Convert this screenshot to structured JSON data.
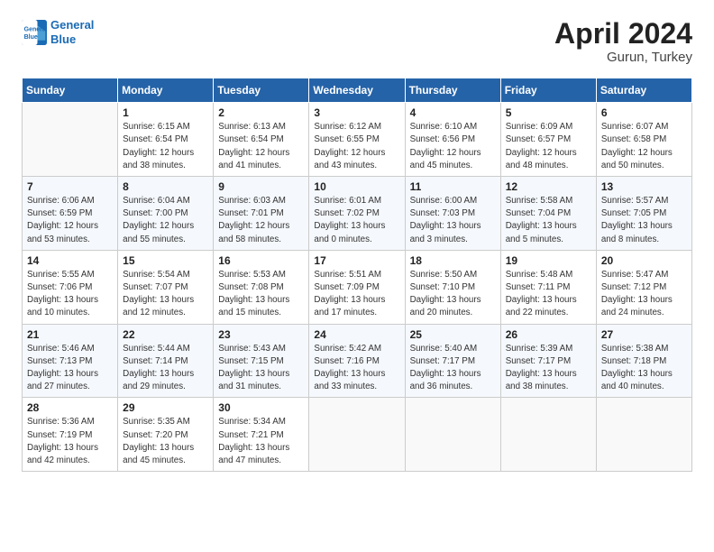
{
  "header": {
    "logo_line1": "General",
    "logo_line2": "Blue",
    "title": "April 2024",
    "location": "Gurun, Turkey"
  },
  "weekdays": [
    "Sunday",
    "Monday",
    "Tuesday",
    "Wednesday",
    "Thursday",
    "Friday",
    "Saturday"
  ],
  "weeks": [
    [
      {
        "day": "",
        "info": ""
      },
      {
        "day": "1",
        "info": "Sunrise: 6:15 AM\nSunset: 6:54 PM\nDaylight: 12 hours\nand 38 minutes."
      },
      {
        "day": "2",
        "info": "Sunrise: 6:13 AM\nSunset: 6:54 PM\nDaylight: 12 hours\nand 41 minutes."
      },
      {
        "day": "3",
        "info": "Sunrise: 6:12 AM\nSunset: 6:55 PM\nDaylight: 12 hours\nand 43 minutes."
      },
      {
        "day": "4",
        "info": "Sunrise: 6:10 AM\nSunset: 6:56 PM\nDaylight: 12 hours\nand 45 minutes."
      },
      {
        "day": "5",
        "info": "Sunrise: 6:09 AM\nSunset: 6:57 PM\nDaylight: 12 hours\nand 48 minutes."
      },
      {
        "day": "6",
        "info": "Sunrise: 6:07 AM\nSunset: 6:58 PM\nDaylight: 12 hours\nand 50 minutes."
      }
    ],
    [
      {
        "day": "7",
        "info": "Sunrise: 6:06 AM\nSunset: 6:59 PM\nDaylight: 12 hours\nand 53 minutes."
      },
      {
        "day": "8",
        "info": "Sunrise: 6:04 AM\nSunset: 7:00 PM\nDaylight: 12 hours\nand 55 minutes."
      },
      {
        "day": "9",
        "info": "Sunrise: 6:03 AM\nSunset: 7:01 PM\nDaylight: 12 hours\nand 58 minutes."
      },
      {
        "day": "10",
        "info": "Sunrise: 6:01 AM\nSunset: 7:02 PM\nDaylight: 13 hours\nand 0 minutes."
      },
      {
        "day": "11",
        "info": "Sunrise: 6:00 AM\nSunset: 7:03 PM\nDaylight: 13 hours\nand 3 minutes."
      },
      {
        "day": "12",
        "info": "Sunrise: 5:58 AM\nSunset: 7:04 PM\nDaylight: 13 hours\nand 5 minutes."
      },
      {
        "day": "13",
        "info": "Sunrise: 5:57 AM\nSunset: 7:05 PM\nDaylight: 13 hours\nand 8 minutes."
      }
    ],
    [
      {
        "day": "14",
        "info": "Sunrise: 5:55 AM\nSunset: 7:06 PM\nDaylight: 13 hours\nand 10 minutes."
      },
      {
        "day": "15",
        "info": "Sunrise: 5:54 AM\nSunset: 7:07 PM\nDaylight: 13 hours\nand 12 minutes."
      },
      {
        "day": "16",
        "info": "Sunrise: 5:53 AM\nSunset: 7:08 PM\nDaylight: 13 hours\nand 15 minutes."
      },
      {
        "day": "17",
        "info": "Sunrise: 5:51 AM\nSunset: 7:09 PM\nDaylight: 13 hours\nand 17 minutes."
      },
      {
        "day": "18",
        "info": "Sunrise: 5:50 AM\nSunset: 7:10 PM\nDaylight: 13 hours\nand 20 minutes."
      },
      {
        "day": "19",
        "info": "Sunrise: 5:48 AM\nSunset: 7:11 PM\nDaylight: 13 hours\nand 22 minutes."
      },
      {
        "day": "20",
        "info": "Sunrise: 5:47 AM\nSunset: 7:12 PM\nDaylight: 13 hours\nand 24 minutes."
      }
    ],
    [
      {
        "day": "21",
        "info": "Sunrise: 5:46 AM\nSunset: 7:13 PM\nDaylight: 13 hours\nand 27 minutes."
      },
      {
        "day": "22",
        "info": "Sunrise: 5:44 AM\nSunset: 7:14 PM\nDaylight: 13 hours\nand 29 minutes."
      },
      {
        "day": "23",
        "info": "Sunrise: 5:43 AM\nSunset: 7:15 PM\nDaylight: 13 hours\nand 31 minutes."
      },
      {
        "day": "24",
        "info": "Sunrise: 5:42 AM\nSunset: 7:16 PM\nDaylight: 13 hours\nand 33 minutes."
      },
      {
        "day": "25",
        "info": "Sunrise: 5:40 AM\nSunset: 7:17 PM\nDaylight: 13 hours\nand 36 minutes."
      },
      {
        "day": "26",
        "info": "Sunrise: 5:39 AM\nSunset: 7:17 PM\nDaylight: 13 hours\nand 38 minutes."
      },
      {
        "day": "27",
        "info": "Sunrise: 5:38 AM\nSunset: 7:18 PM\nDaylight: 13 hours\nand 40 minutes."
      }
    ],
    [
      {
        "day": "28",
        "info": "Sunrise: 5:36 AM\nSunset: 7:19 PM\nDaylight: 13 hours\nand 42 minutes."
      },
      {
        "day": "29",
        "info": "Sunrise: 5:35 AM\nSunset: 7:20 PM\nDaylight: 13 hours\nand 45 minutes."
      },
      {
        "day": "30",
        "info": "Sunrise: 5:34 AM\nSunset: 7:21 PM\nDaylight: 13 hours\nand 47 minutes."
      },
      {
        "day": "",
        "info": ""
      },
      {
        "day": "",
        "info": ""
      },
      {
        "day": "",
        "info": ""
      },
      {
        "day": "",
        "info": ""
      }
    ]
  ]
}
